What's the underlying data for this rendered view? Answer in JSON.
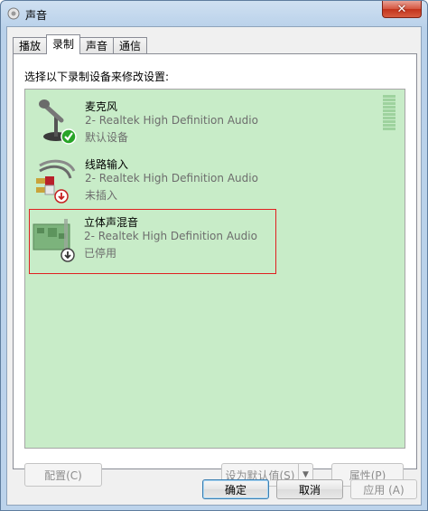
{
  "window": {
    "title": "声音",
    "close_label": "✕"
  },
  "tabs": [
    {
      "label": "播放"
    },
    {
      "label": "录制"
    },
    {
      "label": "声音"
    },
    {
      "label": "通信"
    }
  ],
  "panel": {
    "instruction": "选择以下录制设备来修改设置:"
  },
  "devices": [
    {
      "name": "麦克风",
      "description": "2- Realtek High Definition Audio",
      "status": "默认设备",
      "icon": "microphone-icon"
    },
    {
      "name": "线路输入",
      "description": "2- Realtek High Definition Audio",
      "status": "未插入",
      "icon": "line-in-cable-icon"
    },
    {
      "name": "立体声混音",
      "description": "2- Realtek High Definition Audio",
      "status": "已停用",
      "icon": "sound-card-icon"
    }
  ],
  "panel_buttons": {
    "configure": "配置(C)",
    "set_default": "设为默认值(S)",
    "properties": "属性(P)"
  },
  "dialog_buttons": {
    "ok": "确定",
    "cancel": "取消",
    "apply": "应用 (A)"
  },
  "colors": {
    "list_background": "#c8ecc8",
    "highlight_border": "#e02020"
  }
}
